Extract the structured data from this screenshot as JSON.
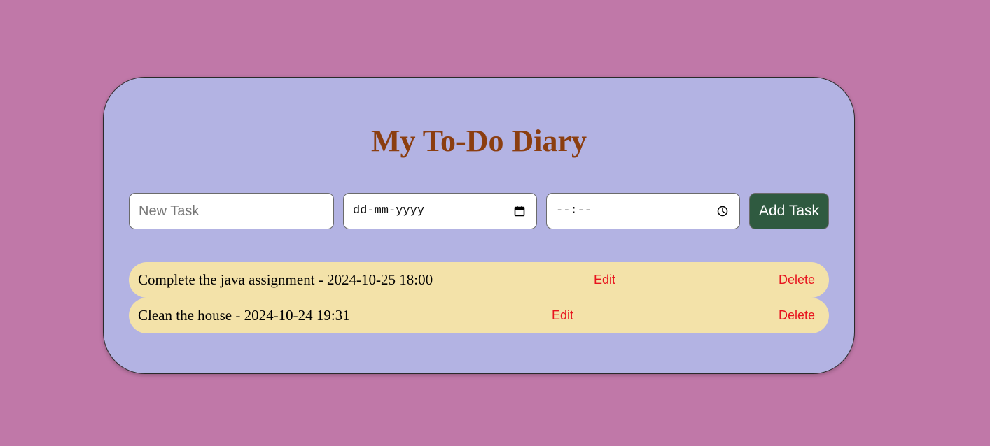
{
  "app": {
    "title": "My To-Do Diary"
  },
  "form": {
    "task_placeholder": "New Task",
    "task_value": "",
    "date_display": "dd-mm-yyyy",
    "time_display": "--:--",
    "add_label": "Add Task"
  },
  "tasks": [
    {
      "text": "Complete the java assignment - 2024-10-25 18:00",
      "edit_label": "Edit",
      "delete_label": "Delete"
    },
    {
      "text": "Clean the house - 2024-10-24 19:31",
      "edit_label": "Edit",
      "delete_label": "Delete"
    }
  ],
  "colors": {
    "page_background": "#c078a8",
    "card_background": "#b3b3e3",
    "title": "#8b3e10",
    "add_button": "#2f5a40",
    "task_row": "#f3e2a9",
    "action_link": "#e8141e"
  },
  "icons": {
    "date_picker": "calendar-icon",
    "time_picker": "clock-icon"
  }
}
